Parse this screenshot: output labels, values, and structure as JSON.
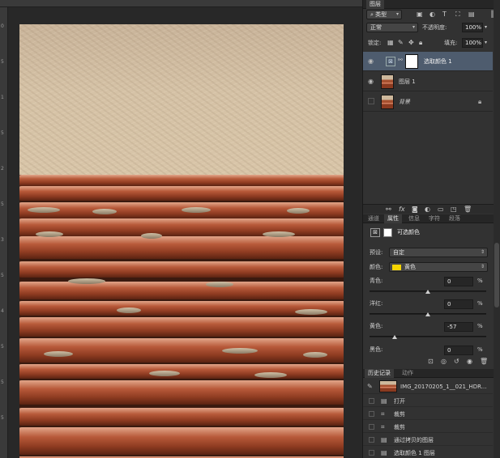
{
  "rulers": {
    "left_ticks": [
      "0",
      "5",
      "1",
      "5",
      "2",
      "5",
      "3",
      "5",
      "4",
      "5",
      "5",
      "5"
    ]
  },
  "layers_panel": {
    "tab_label": "图层",
    "filter_type": "类型",
    "blend_mode": "正常",
    "opacity_label": "不透明度:",
    "opacity_value": "100%",
    "lock_label": "锁定:",
    "fill_label": "填充:",
    "fill_value": "100%",
    "layers": [
      {
        "name": "选取颜色 1",
        "selected": true
      },
      {
        "name": "图层 1",
        "selected": false
      },
      {
        "name": "背景",
        "selected": false
      }
    ]
  },
  "properties_panel": {
    "tabs": [
      "通道",
      "属性",
      "信息",
      "字符",
      "段落"
    ],
    "active_tab": "属性",
    "title": "可选颜色",
    "preset_label": "预设:",
    "preset_value": "自定",
    "color_label": "颜色:",
    "color_value": "黄色",
    "color_swatch": "#f5d400",
    "sliders": [
      {
        "label": "青色:",
        "value": "0",
        "unit": "%",
        "fraction": 0.5
      },
      {
        "label": "洋红:",
        "value": "0",
        "unit": "%",
        "fraction": 0.5
      },
      {
        "label": "黄色:",
        "value": "-57",
        "unit": "%",
        "fraction": 0.215
      },
      {
        "label": "黑色:",
        "value": "0",
        "unit": "%",
        "fraction": 0.5
      }
    ]
  },
  "history_panel": {
    "tabs": [
      "历史记录",
      "动作"
    ],
    "snapshot": "IMG_20170205_1__021_HDR...",
    "items": [
      "打开",
      "裁剪",
      "裁剪",
      "通过拷贝的图层",
      "选取颜色 1 图层"
    ]
  },
  "colors": {
    "panel_bg": "#323232",
    "selected_layer": "#4e5c6e",
    "arrow": "#e8302c"
  }
}
